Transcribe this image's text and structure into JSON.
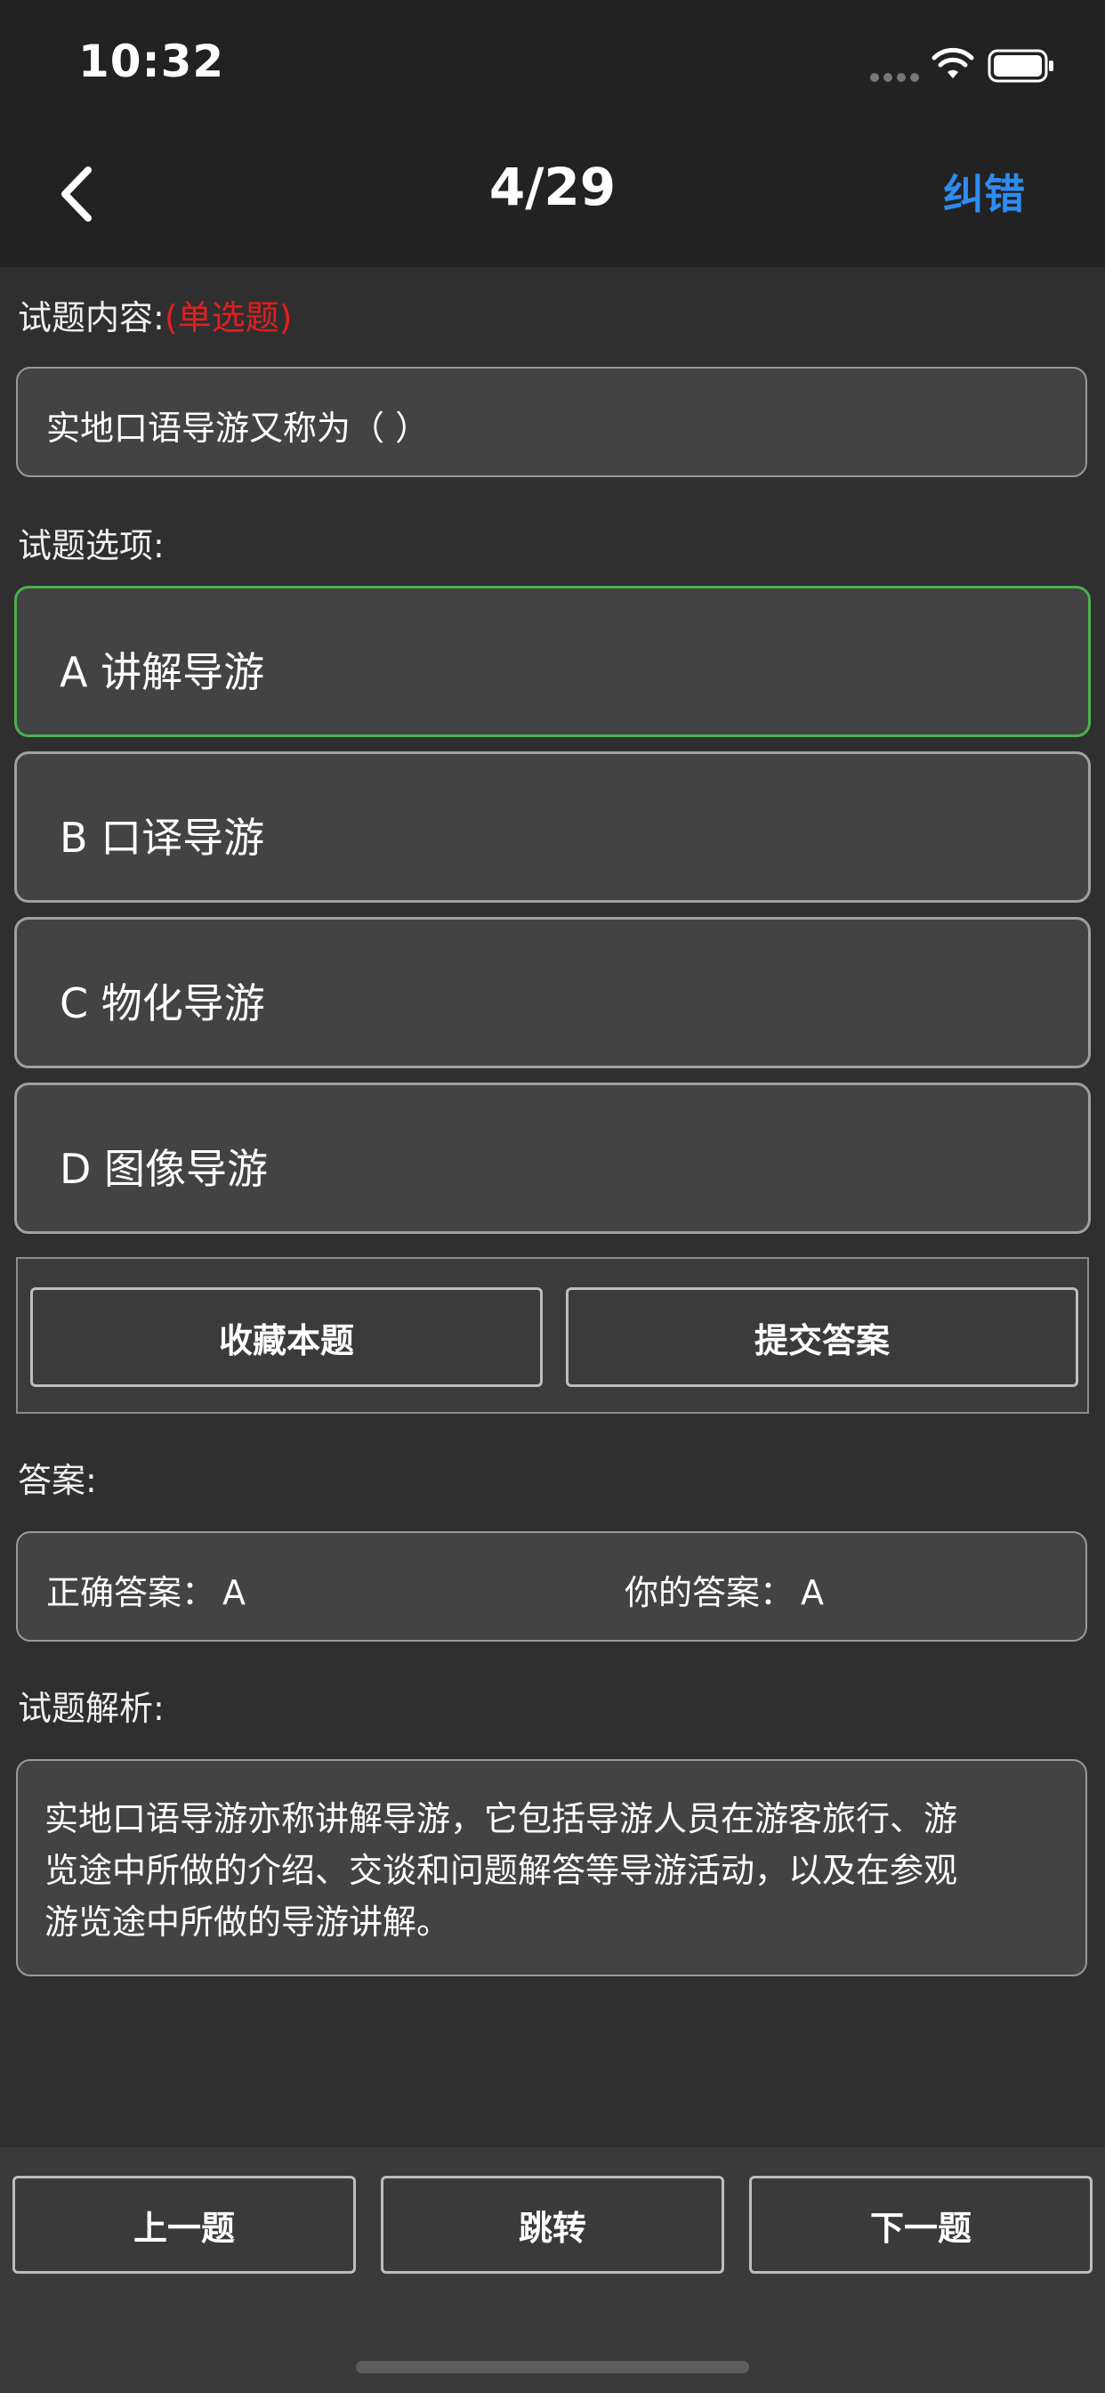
{
  "status_bar": {
    "time": "10:32",
    "icons": [
      "signal-dots-icon",
      "wifi-icon",
      "battery-icon"
    ]
  },
  "nav": {
    "back_icon": "chevron-left-icon",
    "title": "4/29",
    "correct_label": "纠错"
  },
  "question": {
    "content_label": "试题内容:",
    "type_label": "(单选题)",
    "text": "实地口语导游又称为（   ）"
  },
  "options_label": "试题选项:",
  "options": [
    {
      "text": "A 讲解导游",
      "selected": true
    },
    {
      "text": "B 口译导游",
      "selected": false
    },
    {
      "text": "C 物化导游",
      "selected": false
    },
    {
      "text": "D 图像导游",
      "selected": false
    }
  ],
  "actions": {
    "favorite_label": "收藏本题",
    "submit_label": "提交答案"
  },
  "answer": {
    "label": "答案:",
    "correct_prefix": "正确答案：",
    "correct_value": "A",
    "yours_prefix": "你的答案：",
    "yours_value": "A"
  },
  "analysis": {
    "label": "试题解析:",
    "lines": [
      "实地口语导游亦称讲解导游，它包括导游人员在游客旅行、游",
      "览途中所做的介绍、交谈和问题解答等导游活动，以及在参观",
      "游览途中所做的导游讲解。"
    ]
  },
  "bottom_nav": {
    "prev_label": "上一题",
    "jump_label": "跳转",
    "next_label": "下一题"
  },
  "colors": {
    "accent_blue": "#2d8cf0",
    "type_red": "#e02020",
    "selected_green": "#4caf50",
    "background": "#2f2f2f"
  }
}
